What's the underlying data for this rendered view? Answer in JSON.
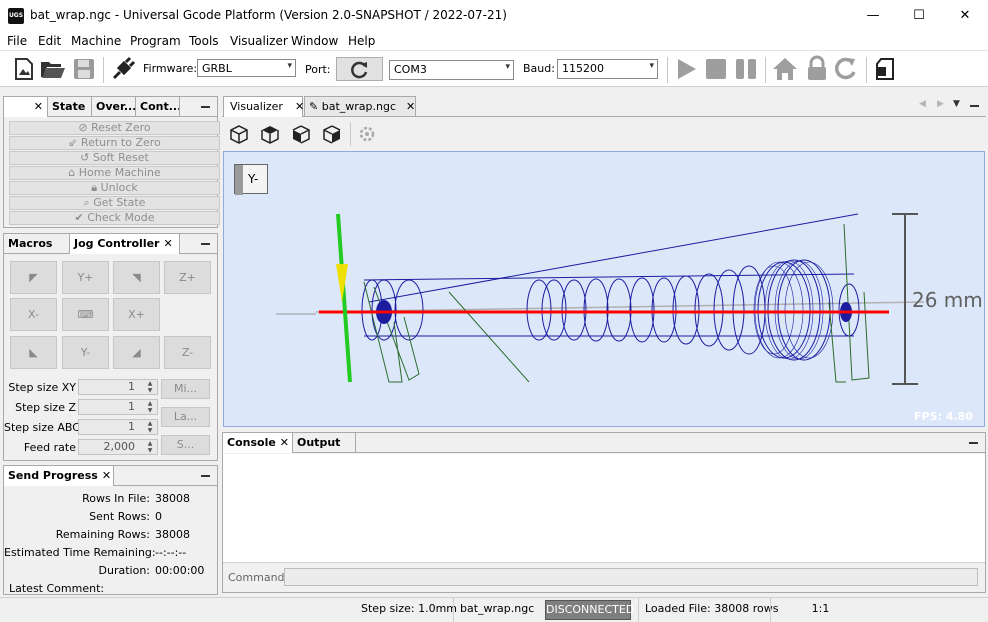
{
  "window": {
    "title": "bat_wrap.ngc - Universal Gcode Platform (Version 2.0-SNAPSHOT / 2022-07-21)",
    "app_icon_text": "UGS",
    "minimize": "—",
    "maximize": "☐",
    "close": "✕"
  },
  "menu": [
    "File",
    "Edit",
    "Machine",
    "Program",
    "Tools",
    "Visualizer",
    "Window",
    "Help"
  ],
  "toolbar": {
    "firmware_label": "Firmware:",
    "firmware_value": "GRBL",
    "port_label": "Port:",
    "port_value": "COM3",
    "baud_label": "Baud:",
    "baud_value": "115200"
  },
  "left_top_panel": {
    "tabs": [
      "",
      "State",
      "Over...",
      "Cont..."
    ],
    "actions": [
      "Reset Zero",
      "Return to Zero",
      "Soft Reset",
      "Home Machine",
      "Unlock",
      "Get State",
      "Check Mode"
    ]
  },
  "jog_panel": {
    "tabs": [
      "Macros",
      "Jog Controller"
    ],
    "buttons": {
      "up_left": "◤",
      "y_plus": "Y+",
      "up_right": "◥",
      "z_plus": "Z+",
      "x_minus": "X-",
      "keyboard": "⌨",
      "x_plus": "X+",
      "down_left": "◣",
      "y_minus": "Y-",
      "down_right": "◢",
      "z_minus": "Z-"
    },
    "fields": [
      {
        "label": "Step size XY",
        "value": "1"
      },
      {
        "label": "Step size Z",
        "value": "1"
      },
      {
        "label": "Step size ABC",
        "value": "1"
      },
      {
        "label": "Feed rate",
        "value": "2,000"
      }
    ],
    "side_buttons": [
      "Mi...",
      "La...",
      "S..."
    ]
  },
  "send_progress": {
    "tab": "Send Progress",
    "rows": [
      {
        "label": "Rows In File:",
        "value": "38008"
      },
      {
        "label": "Sent Rows:",
        "value": "0"
      },
      {
        "label": "Remaining Rows:",
        "value": "38008"
      },
      {
        "label": "Estimated Time Remaining:",
        "value": "--:--:--"
      },
      {
        "label": "Duration:",
        "value": "00:00:00"
      }
    ],
    "latest_comment_label": "Latest Comment:"
  },
  "editor_tabs": [
    "Visualizer",
    "bat_wrap.ngc"
  ],
  "visualizer": {
    "view_cube_label": "Y-",
    "dimension_label": "26 mm",
    "fps": "FPS: 4.80",
    "colors": {
      "background": "#dce8fa",
      "toolpath": "#1c1ca0",
      "x_axis": "#ff0000",
      "y_axis": "#22cc22"
    }
  },
  "console": {
    "tabs": [
      "Console",
      "Output"
    ],
    "command_label": "Command:"
  },
  "statusbar": {
    "step_size": "Step size: 1.0mm",
    "file": "bat_wrap.ngc",
    "connection": "DISCONNECTED",
    "loaded": "Loaded File: 38008 rows",
    "ratio": "1:1"
  }
}
